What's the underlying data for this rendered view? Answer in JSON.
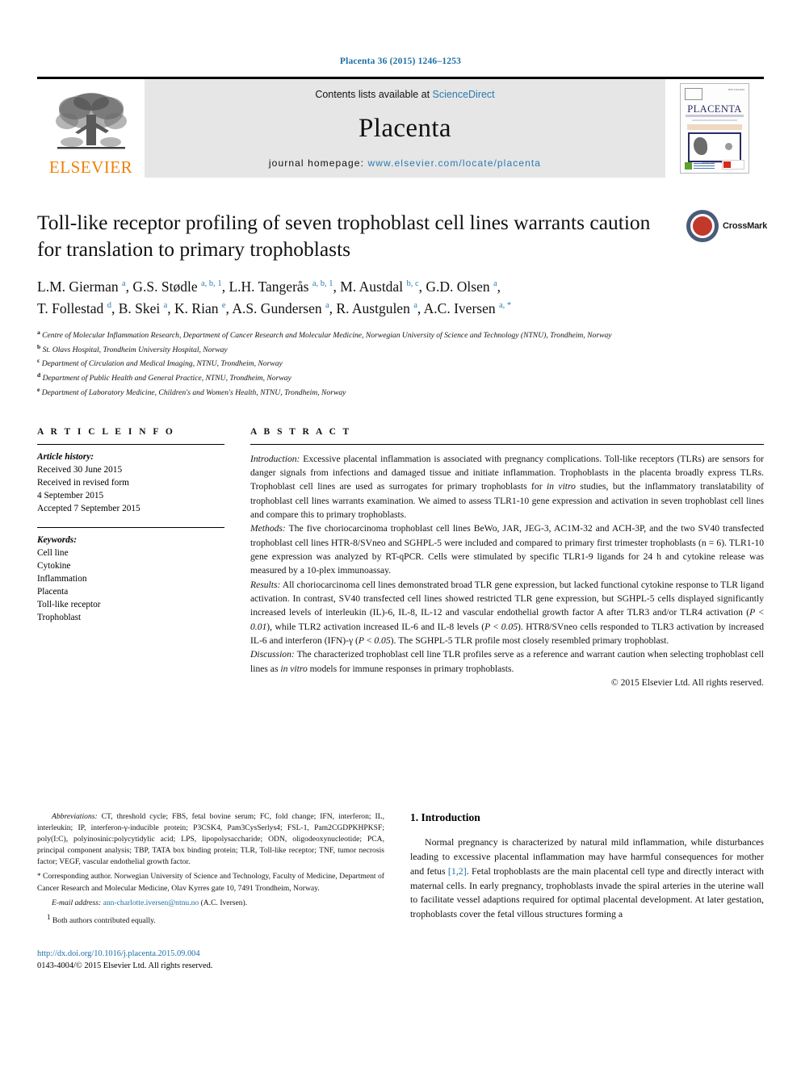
{
  "running_head": "Placenta 36 (2015) 1246–1253",
  "masthead": {
    "publisher_name": "ELSEVIER",
    "contents_prefix": "Contents lists available at ",
    "contents_link": "ScienceDirect",
    "journal_name": "Placenta",
    "homepage_prefix": "journal homepage: ",
    "homepage_link": "www.elsevier.com/locate/placenta",
    "cover_title": "PLACENTA",
    "cover_issn": "ISSN 0143-4004",
    "cover_caption": "Official Journal of the IFPA"
  },
  "article": {
    "title": "Toll-like receptor profiling of seven trophoblast cell lines warrants caution for translation to primary trophoblasts",
    "crossmark_label": "CrossMark",
    "authors_line1": "L.M. Gierman <sup>a</sup>, G.S. Stødle <sup>a, b, 1</sup>, L.H. Tangerås <sup>a, b, 1</sup>, M. Austdal <sup>b, c</sup>, G.D. Olsen <sup>a</sup>,",
    "authors_line2": "T. Follestad <sup>d</sup>, B. Skei <sup>a</sup>, K. Rian <sup>e</sup>, A.S. Gundersen <sup>a</sup>, R. Austgulen <sup>a</sup>, A.C. Iversen <sup>a, *</sup>",
    "affiliations": [
      "<sup>a</sup> Centre of Molecular Inflammation Research, Department of Cancer Research and Molecular Medicine, Norwegian University of Science and Technology (NTNU), Trondheim, Norway",
      "<sup>b</sup> St. Olavs Hospital, Trondheim University Hospital, Norway",
      "<sup>c</sup> Department of Circulation and Medical Imaging, NTNU, Trondheim, Norway",
      "<sup>d</sup> Department of Public Health and General Practice, NTNU, Trondheim, Norway",
      "<sup>e</sup> Department of Laboratory Medicine, Children's and Women's Health, NTNU, Trondheim, Norway"
    ]
  },
  "article_info": {
    "heading": "A R T I C L E  I N F O",
    "history_label": "Article history:",
    "history_lines": [
      "Received 30 June 2015",
      "Received in revised form",
      "4 September 2015",
      "Accepted 7 September 2015"
    ],
    "keywords_label": "Keywords:",
    "keywords": [
      "Cell line",
      "Cytokine",
      "Inflammation",
      "Placenta",
      "Toll-like receptor",
      "Trophoblast"
    ]
  },
  "abstract": {
    "heading": "A B S T R A C T",
    "introduction_label": "Introduction:",
    "introduction_text": " Excessive placental inflammation is associated with pregnancy complications. Toll-like receptors (TLRs) are sensors for danger signals from infections and damaged tissue and initiate inflammation. Trophoblasts in the placenta broadly express TLRs. Trophoblast cell lines are used as surrogates for primary trophoblasts for <span class=\"ital\">in vitro</span> studies, but the inflammatory translatability of trophoblast cell lines warrants examination. We aimed to assess TLR1-10 gene expression and activation in seven trophoblast cell lines and compare this to primary trophoblasts.",
    "methods_label": "Methods:",
    "methods_text": " The five choriocarcinoma trophoblast cell lines BeWo, JAR, JEG-3, AC1M-32 and ACH-3P, and the two SV40 transfected trophoblast cell lines HTR-8/SVneo and SGHPL-5 were included and compared to primary first trimester trophoblasts (n = 6). TLR1-10 gene expression was analyzed by RT-qPCR. Cells were stimulated by specific TLR1-9 ligands for 24 h and cytokine release was measured by a 10-plex immunoassay.",
    "results_label": "Results:",
    "results_text": " All choriocarcinoma cell lines demonstrated broad TLR gene expression, but lacked functional cytokine response to TLR ligand activation. In contrast, SV40 transfected cell lines showed restricted TLR gene expression, but SGHPL-5 cells displayed significantly increased levels of interleukin (IL)-6, IL-8, IL-12 and vascular endothelial growth factor A after TLR3 and/or TLR4 activation (<span class=\"ital\">P</span> &lt; <span class=\"ital\">0.01</span>), while TLR2 activation increased IL-6 and IL-8 levels (<span class=\"ital\">P</span> &lt; <span class=\"ital\">0.05</span>). HTR8/SVneo cells responded to TLR3 activation by increased IL-6 and interferon (IFN)-γ (<span class=\"ital\">P</span> &lt; <span class=\"ital\">0.05</span>). The SGHPL-5 TLR profile most closely resembled primary trophoblast.",
    "discussion_label": "Discussion:",
    "discussion_text": " The characterized trophoblast cell line TLR profiles serve as a reference and warrant caution when selecting trophoblast cell lines as <span class=\"ital\">in vitro</span> models for immune responses in primary trophoblasts.",
    "copyright": "© 2015 Elsevier Ltd. All rights reserved."
  },
  "footnotes": {
    "abbreviations_label": "Abbreviations:",
    "abbreviations_text": " CT, threshold cycle; FBS, fetal bovine serum; FC, fold change; IFN, interferon; IL, interleukin; IP, interferon-γ-inducible protein; P3CSK4, Pam3CysSerlys4; FSL-1, Pam2CGDPKHPKSF; poly(I:C), polyinosinic:polycytidylic acid; LPS, lipopolysaccharide; ODN, oligodeoxynucleotide; PCA, principal component analysis; TBP, TATA box binding protein; TLR, Toll-like receptor; TNF, tumor necrosis factor; VEGF, vascular endothelial growth factor.",
    "corresponding_mark": "*",
    "corresponding_text": " Corresponding author. Norwegian University of Science and Technology, Faculty of Medicine, Department of Cancer Research and Molecular Medicine, Olav Kyrres gate 10, 7491 Trondheim, Norway.",
    "email_label": "E-mail address:",
    "email_link": "ann-charlotte.iversen@ntnu.no",
    "email_suffix": " (A.C. Iversen).",
    "equal_mark": "1",
    "equal_text": " Both authors contributed equally."
  },
  "publication": {
    "doi_url": "http://dx.doi.org/10.1016/j.placenta.2015.09.004",
    "issn_line": "0143-4004/© 2015 Elsevier Ltd. All rights reserved."
  },
  "introduction": {
    "number_heading": "1.  Introduction",
    "paragraph": "Normal pregnancy is characterized by natural mild inflammation, while disturbances leading to excessive placental inflammation may have harmful consequences for mother and fetus <a href=\"#\">[1,2]</a>. Fetal trophoblasts are the main placental cell type and directly interact with maternal cells. In early pregnancy, trophoblasts invade the spiral arteries in the uterine wall to facilitate vessel adaptions required for optimal placental development. At later gestation, trophoblasts cover the fetal villous structures forming a"
  },
  "colors": {
    "link_blue": "#1d6fa5",
    "elsevier_orange": "#f07f09",
    "masthead_grey": "#e6e6e6"
  }
}
